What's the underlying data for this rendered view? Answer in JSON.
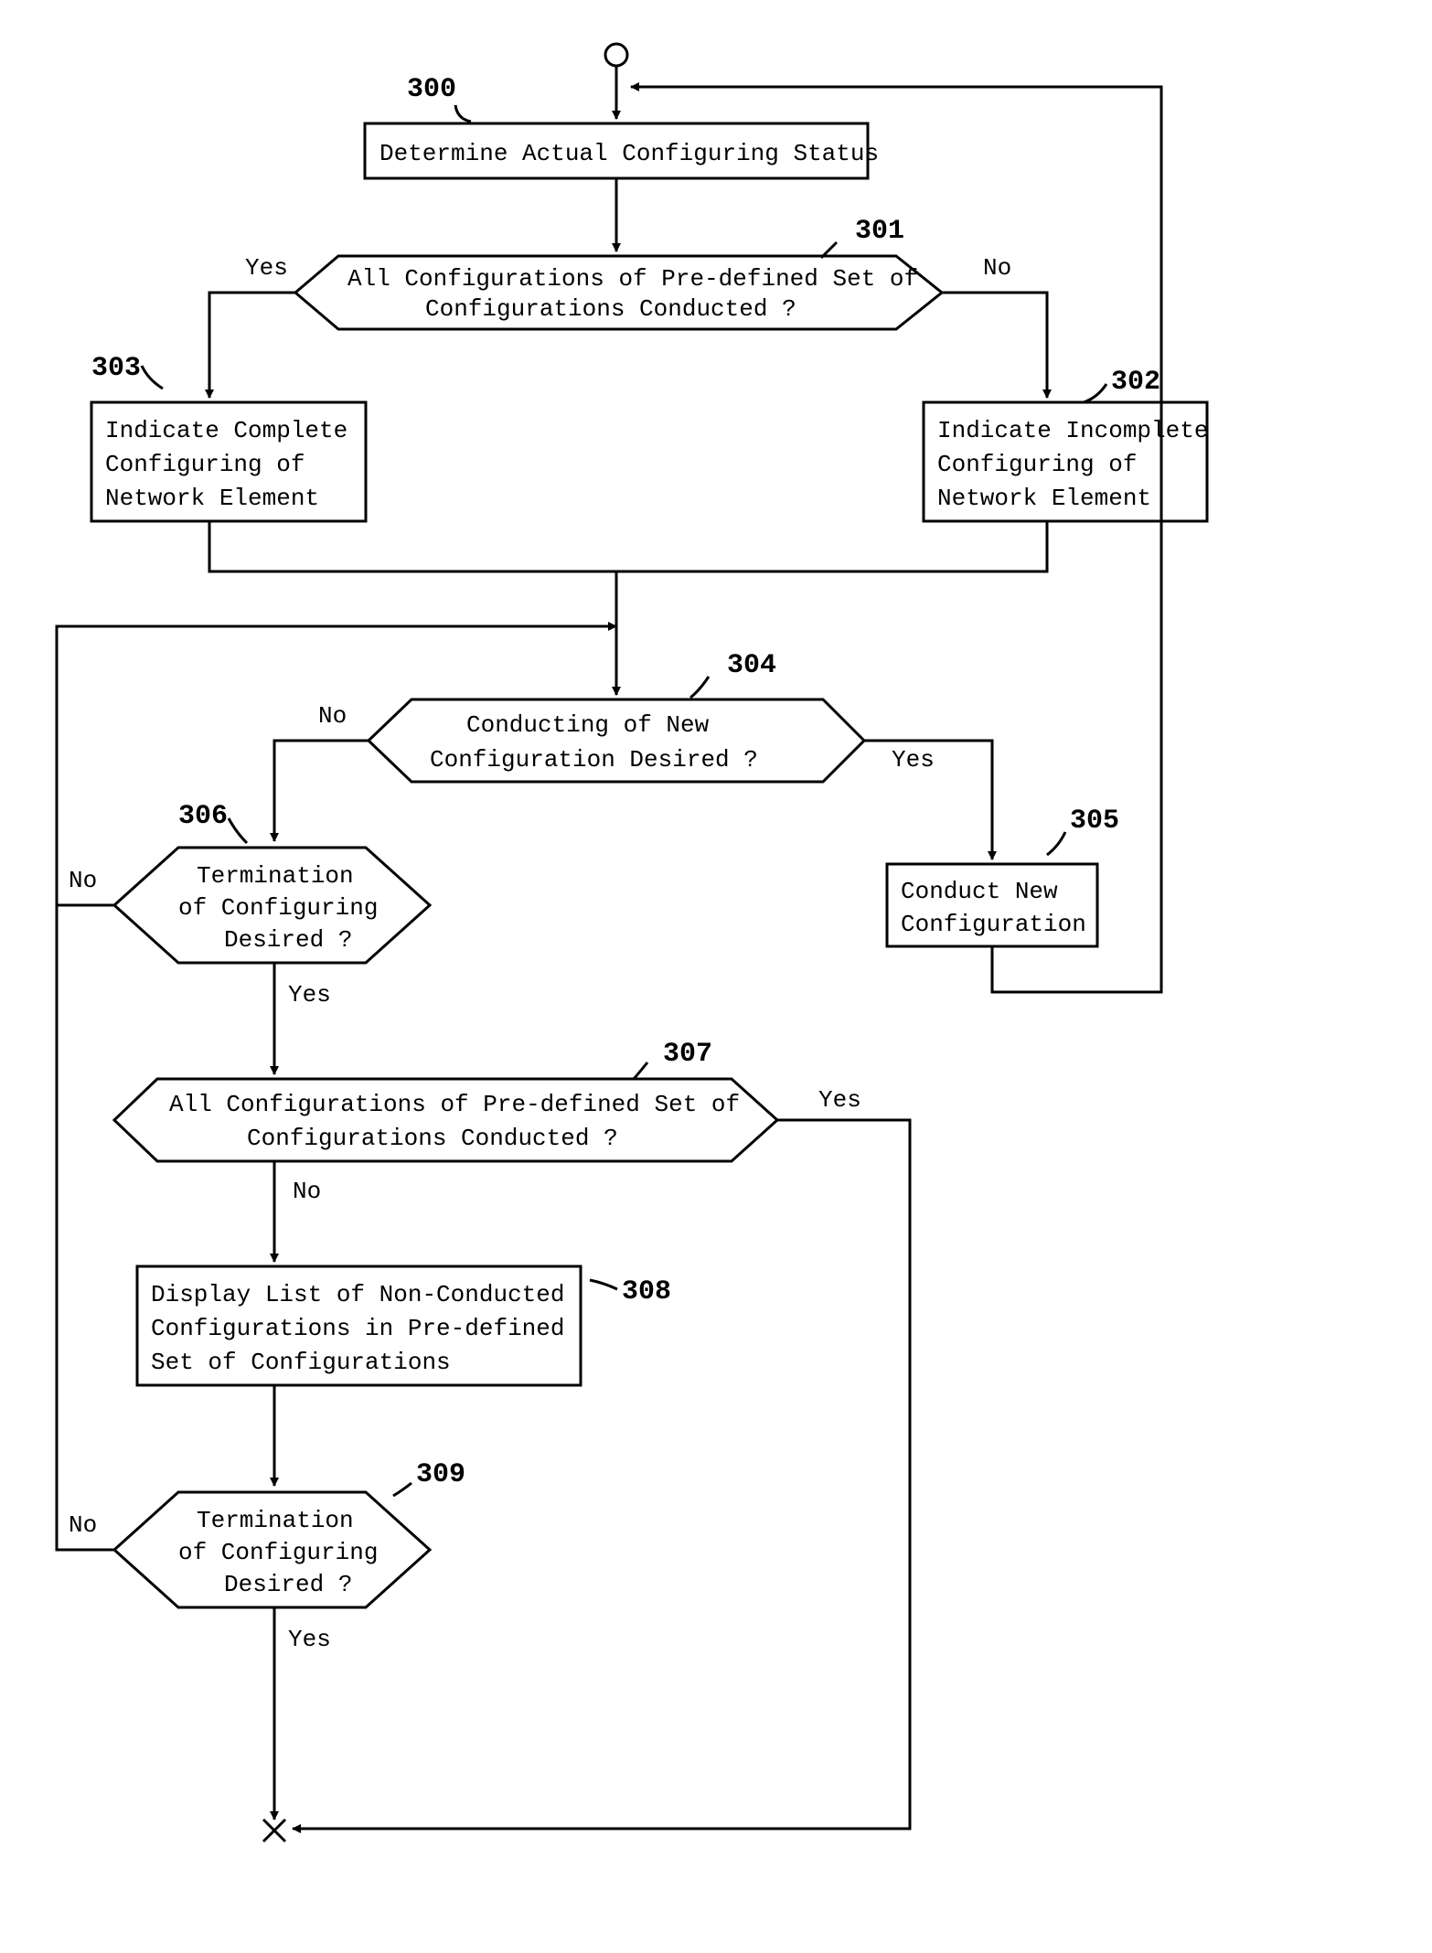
{
  "labels": {
    "n300": "300",
    "n301": "301",
    "n302": "302",
    "n303": "303",
    "n304": "304",
    "n305": "305",
    "n306": "306",
    "n307": "307",
    "n308": "308",
    "n309": "309",
    "box300": "Determine Actual Configuring Status",
    "dec301a": "All Configurations of Pre-defined Set of",
    "dec301b": "Configurations Conducted ?",
    "box303a": "Indicate Complete",
    "box303b": "Configuring of",
    "box303c": "Network Element",
    "box302a": "Indicate Incomplete",
    "box302b": "Configuring of",
    "box302c": "Network Element",
    "dec304a": "Conducting of New",
    "dec304b": "Configuration Desired ?",
    "box305a": "Conduct New",
    "box305b": "Configuration",
    "dec306a": "Termination",
    "dec306b": "of Configuring",
    "dec306c": "Desired ?",
    "dec307a": "All Configurations of Pre-defined Set of",
    "dec307b": "Configurations Conducted ?",
    "box308a": "Display List of Non-Conducted",
    "box308b": "Configurations in Pre-defined",
    "box308c": "Set of Configurations",
    "dec309a": "Termination",
    "dec309b": "of Configuring",
    "dec309c": "Desired ?",
    "yes": "Yes",
    "no": "No"
  }
}
